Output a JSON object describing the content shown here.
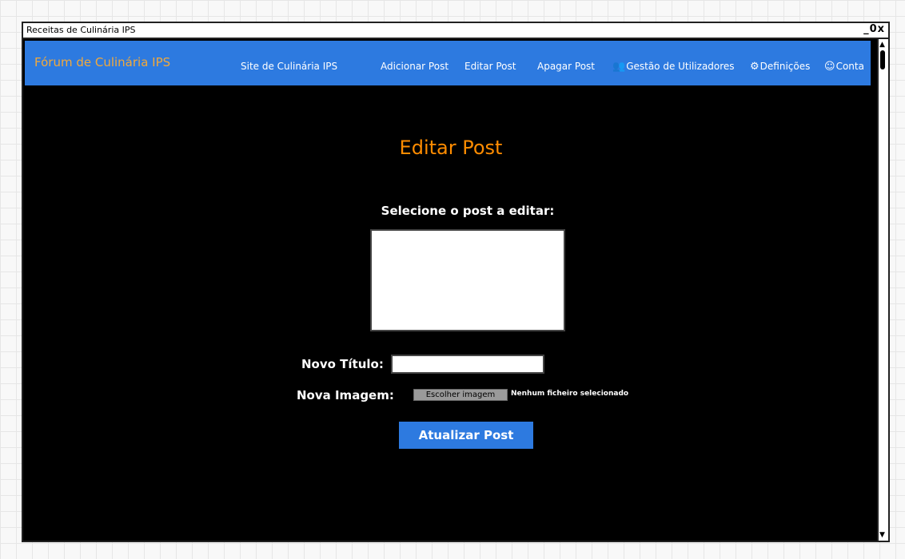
{
  "window": {
    "title": "Receitas de Culinária IPS",
    "controls": "_0x"
  },
  "navbar": {
    "brand": "Fórum de Culinária IPS",
    "links": [
      {
        "label": "Site de Culinária IPS"
      },
      {
        "label": "Adicionar Post"
      },
      {
        "label": "Editar Post"
      },
      {
        "label": "Apagar Post"
      },
      {
        "label": "Gestão de Utilizadores",
        "icon": "users-icon"
      },
      {
        "label": "Definições",
        "icon": "gear-icon"
      },
      {
        "label": "Conta",
        "icon": "user-circle-icon"
      }
    ]
  },
  "main": {
    "page_title": "Editar Post",
    "select_label": "Selecione o post a editar:",
    "new_title_label": "Novo Título:",
    "new_title_value": "",
    "new_image_label": "Nova Imagem:",
    "file_button_label": "Escolher imagem",
    "file_status": "Nenhum ficheiro selecionado",
    "submit_label": "Atualizar Post"
  },
  "colors": {
    "navbar_bg": "#2d7ae0",
    "brand": "#f2a93b",
    "page_title": "#ff8c00",
    "background": "#000000"
  }
}
